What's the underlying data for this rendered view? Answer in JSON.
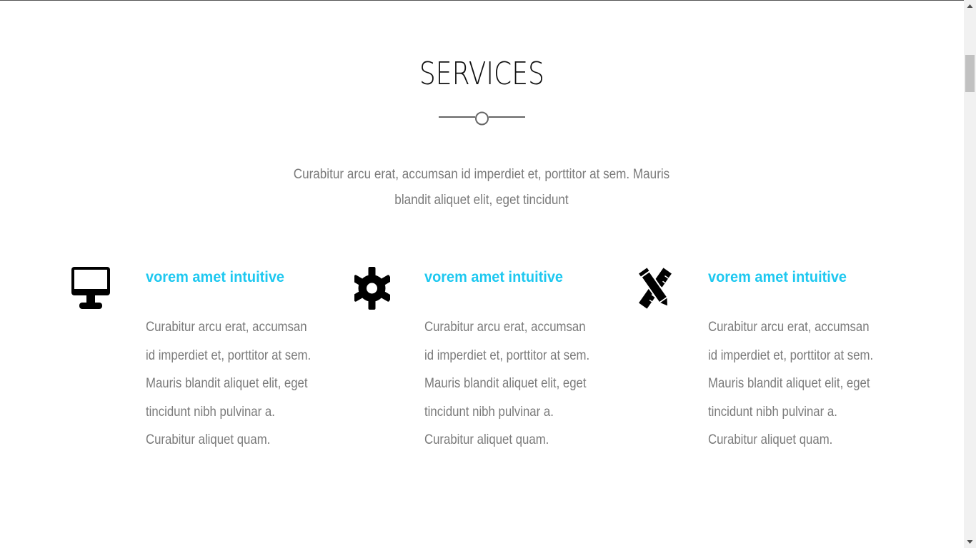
{
  "section": {
    "title": "SERVICES",
    "intro": "Curabitur arcu erat, accumsan id imperdiet et, porttitor at sem. Mauris blandit aliquet elit, eget tincidunt"
  },
  "services": [
    {
      "icon": "desktop-icon",
      "title": "vorem amet intuitive",
      "text": "Curabitur arcu erat, accumsan id imperdiet et, porttitor at sem. Mauris blandit aliquet elit, eget tincidunt nibh pulvinar a. Curabitur aliquet quam."
    },
    {
      "icon": "gear-icon",
      "title": "vorem amet intuitive",
      "text": "Curabitur arcu erat, accumsan id imperdiet et, porttitor at sem. Mauris blandit aliquet elit, eget tincidunt nibh pulvinar a. Curabitur aliquet quam."
    },
    {
      "icon": "pencil-ruler-icon",
      "title": "vorem amet intuitive",
      "text": "Curabitur arcu erat, accumsan id imperdiet et, porttitor at sem. Mauris blandit aliquet elit, eget tincidunt nibh pulvinar a. Curabitur aliquet quam."
    }
  ],
  "colors": {
    "accent": "#1ec8f0",
    "body_text": "#7a7a7a",
    "heading": "#111111"
  }
}
